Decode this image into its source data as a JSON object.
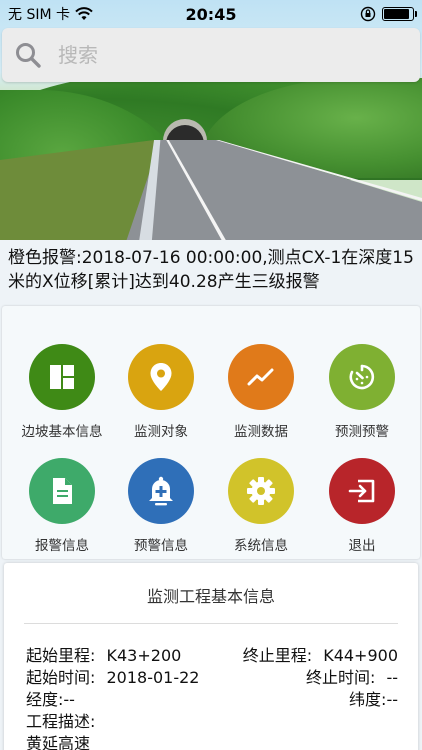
{
  "status_bar": {
    "carrier": "无 SIM 卡",
    "time": "20:45",
    "wifi_icon": "wifi-icon",
    "orientation_lock_icon": "orientation-lock-icon",
    "battery_level": 0.9
  },
  "search": {
    "placeholder": "搜索",
    "icon": "search-icon"
  },
  "alert": {
    "text": "橙色报警:2018-07-16 00:00:00,测点CX-1在深度15米的X位移[累计]达到40.28产生三级报警"
  },
  "menu": {
    "items": [
      {
        "label": "边坡基本信息",
        "icon": "grid-icon",
        "color": "#3f8a16"
      },
      {
        "label": "监测对象",
        "icon": "location-pin-icon",
        "color": "#d9a410"
      },
      {
        "label": "监测数据",
        "icon": "trend-line-icon",
        "color": "#e07a1a"
      },
      {
        "label": "预测预警",
        "icon": "timer-icon",
        "color": "#7fb032"
      },
      {
        "label": "报警信息",
        "icon": "document-icon",
        "color": "#3eaa6a"
      },
      {
        "label": "预警信息",
        "icon": "bell-plus-icon",
        "color": "#2f6fb8"
      },
      {
        "label": "系统信息",
        "icon": "gear-icon",
        "color": "#d1c32a"
      },
      {
        "label": "退出",
        "icon": "exit-icon",
        "color": "#b8252a"
      }
    ]
  },
  "info": {
    "title": "监测工程基本信息",
    "start_mileage_label": "起始里程:",
    "start_mileage_value": "K43+200",
    "end_mileage_label": "终止里程:",
    "end_mileage_value": "K44+900",
    "start_time_label": "起始时间:",
    "start_time_value": "2018-01-22",
    "end_time_label": "终止时间:",
    "end_time_value": "--",
    "longitude_label": "经度:",
    "longitude_value": "--",
    "latitude_label": "纬度:",
    "latitude_value": "--",
    "description_label": "工程描述:",
    "description_value": "黄延高速"
  }
}
